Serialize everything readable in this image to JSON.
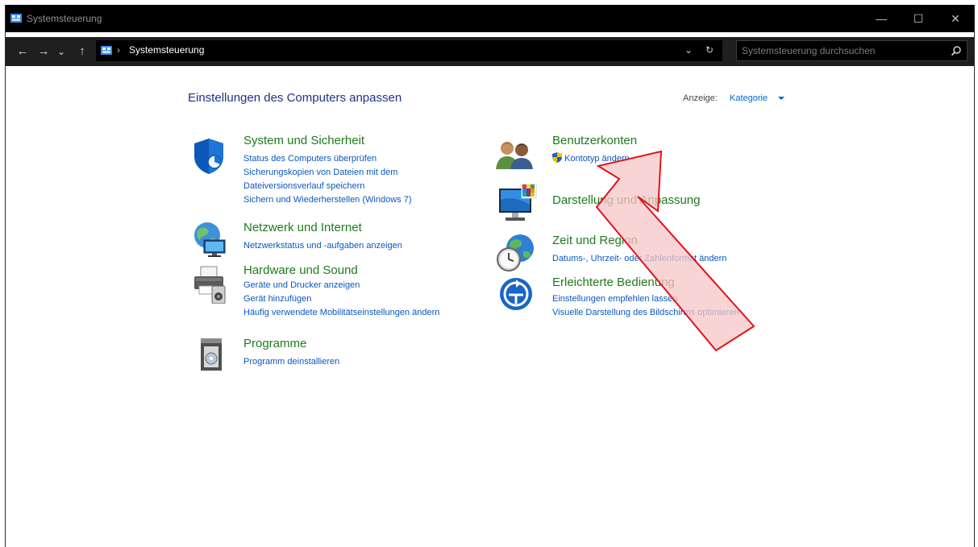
{
  "window": {
    "title": "Systemsteuerung",
    "buttons": {
      "minimize": "—",
      "maximize": "☐",
      "close": "✕"
    }
  },
  "addressbar": {
    "back": "←",
    "forward": "→",
    "recent": "⌄",
    "up": "↑",
    "separator": "›",
    "path": "Systemsteuerung",
    "dropdown": "⌄",
    "refresh": "↻",
    "search_placeholder": "Systemsteuerung durchsuchen"
  },
  "main": {
    "heading": "Einstellungen des Computers anpassen",
    "view_label": "Anzeige:",
    "view_value": "Kategorie"
  },
  "categories": [
    {
      "title": "System und Sicherheit",
      "icon": "shield-icon",
      "links": [
        "Status des Computers überprüfen",
        "Sicherungskopien von Dateien mit dem Dateiversionsverlauf speichern",
        "Sichern und Wiederherstellen (Windows 7)"
      ]
    },
    {
      "title": "Netzwerk und Internet",
      "icon": "network-icon",
      "links": [
        "Netzwerkstatus und -aufgaben anzeigen"
      ]
    },
    {
      "title": "Hardware und Sound",
      "icon": "printer-icon",
      "links": [
        "Geräte und Drucker anzeigen",
        "Gerät hinzufügen",
        "Häufig verwendete Mobilitätseinstellungen ändern"
      ]
    },
    {
      "title": "Programme",
      "icon": "programs-icon",
      "links": [
        "Programm deinstallieren"
      ]
    },
    {
      "title": "Benutzerkonten",
      "icon": "users-icon",
      "links": [
        "Kontotyp ändern"
      ]
    },
    {
      "title": "Darstellung und Anpassung",
      "icon": "monitor-icon",
      "links": []
    },
    {
      "title": "Zeit und Region",
      "icon": "clock-globe-icon",
      "links": [
        "Datums-, Uhrzeit- oder Zahlenformat ändern"
      ]
    },
    {
      "title": "Erleichterte Bedienung",
      "icon": "accessibility-icon",
      "links": [
        "Einstellungen empfehlen lassen",
        "Visuelle Darstellung des Bildschirms optimieren"
      ]
    }
  ],
  "colors": {
    "titlebar": "#000000",
    "category_title": "#1e7a1e",
    "link": "#0a57c2",
    "heading": "#1e3287",
    "arrow_fill": "#f7c6c6",
    "arrow_stroke": "#e0141e"
  }
}
